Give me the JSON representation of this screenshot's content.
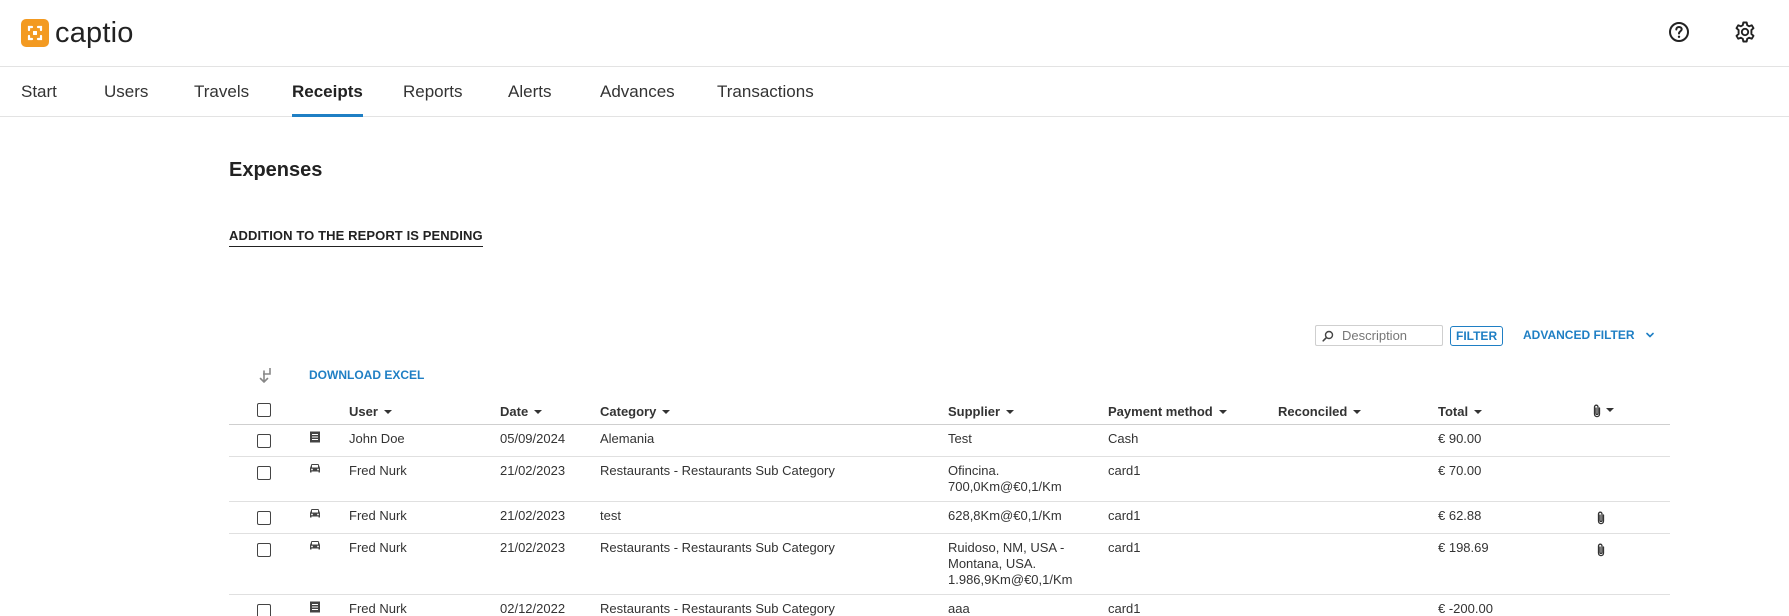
{
  "app": {
    "name": "captio"
  },
  "nav": {
    "tabs": [
      {
        "label": "Start"
      },
      {
        "label": "Users"
      },
      {
        "label": "Travels"
      },
      {
        "label": "Receipts"
      },
      {
        "label": "Reports"
      },
      {
        "label": "Alerts"
      },
      {
        "label": "Advances"
      },
      {
        "label": "Transactions"
      }
    ],
    "active": "Receipts"
  },
  "page": {
    "title": "Expenses",
    "pending_link": "ADDITION TO THE REPORT IS PENDING"
  },
  "toolbar": {
    "search_placeholder": "Description",
    "filter_label": "FILTER",
    "advanced_filter_label": "ADVANCED FILTER",
    "download_label": "DOWNLOAD EXCEL"
  },
  "table": {
    "headers": {
      "user": "User",
      "date": "Date",
      "category": "Category",
      "supplier": "Supplier",
      "payment": "Payment method",
      "reconciled": "Reconciled",
      "total": "Total"
    },
    "rows": [
      {
        "icon": "receipt-icon",
        "user": "John Doe",
        "date": "05/09/2024",
        "category": "Alemania",
        "supplier": "Test",
        "payment": "Cash",
        "reconciled": "",
        "total": "€ 90.00",
        "attachment": false
      },
      {
        "icon": "car-icon",
        "user": "Fred Nurk",
        "date": "21/02/2023",
        "category": "Restaurants - Restaurants Sub Category",
        "supplier": "Ofincina. 700,0Km@€0,1/Km",
        "payment": "card1",
        "reconciled": "",
        "total": "€ 70.00",
        "attachment": false
      },
      {
        "icon": "car-icon",
        "user": "Fred Nurk",
        "date": "21/02/2023",
        "category": "test",
        "supplier": "628,8Km@€0,1/Km",
        "payment": "card1",
        "reconciled": "",
        "total": "€ 62.88",
        "attachment": true
      },
      {
        "icon": "car-icon",
        "user": "Fred Nurk",
        "date": "21/02/2023",
        "category": "Restaurants - Restaurants Sub Category",
        "supplier": "Ruidoso, NM, USA - Montana, USA. 1.986,9Km@€0,1/Km",
        "payment": "card1",
        "reconciled": "",
        "total": "€ 198.69",
        "attachment": true
      },
      {
        "icon": "receipt-icon",
        "user": "Fred Nurk",
        "date": "02/12/2022",
        "category": "Restaurants - Restaurants Sub Category",
        "supplier": "aaa",
        "payment": "card1",
        "reconciled": "",
        "total": "€ -200.00",
        "attachment": false
      }
    ]
  },
  "colors": {
    "accent": "#1f7fc4",
    "brand": "#f39a21"
  }
}
